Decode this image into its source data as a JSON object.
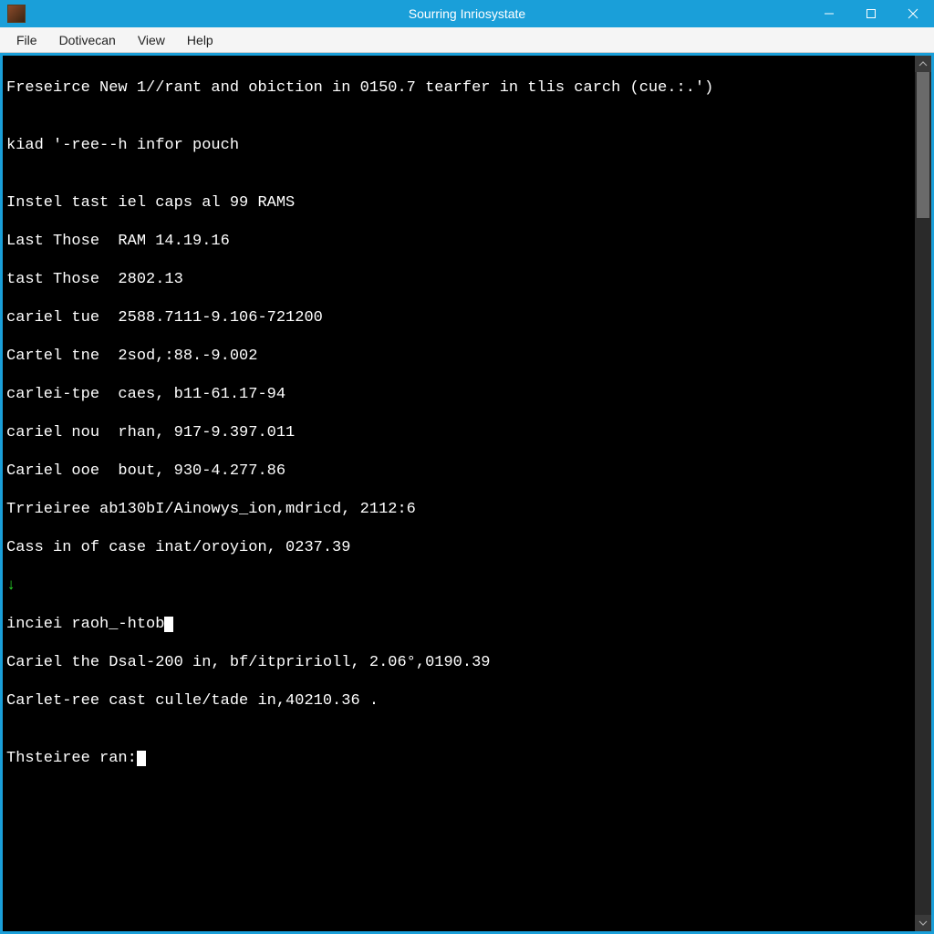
{
  "window": {
    "title": "Sourring Inriosystate"
  },
  "menu": {
    "items": [
      "File",
      "Dotivecan",
      "View",
      "Help"
    ]
  },
  "terminal": {
    "lines": [
      "Freseirce New 1//rant and obiction in 0150.7 tearfer in tlis carch (cue.:.')",
      "",
      "kiad '-ree--h infor pouch",
      "",
      "Instel tast iel caps al 99 RAMS",
      "Last Those  RAM 14.19.16",
      "tast Those  2802.13",
      "cariel tue  2588.7111-9.106-721200",
      "Cartel tne  2sod,:88.-9.002",
      "carlei-tpe  caes, b11-61.17-94",
      "cariel nou  rhan, 917-9.397.011",
      "Cariel ooe  bout, 930-4.277.86",
      "Trrieiree ab130bI/Ainowys_ion,mdricd, 2112:6",
      "Cass in of case inat/oroyion, 0237.39"
    ],
    "green_marker": "↓",
    "after_green": "inciei raoh_-htob",
    "tail_lines": [
      "Cariel the Dsal-200 in, bf/itpririoll, 2.06°,0190.39",
      "Carlet-ree cast culle/tade in,40210.36 .",
      "",
      "Thsteiree ran:"
    ]
  }
}
